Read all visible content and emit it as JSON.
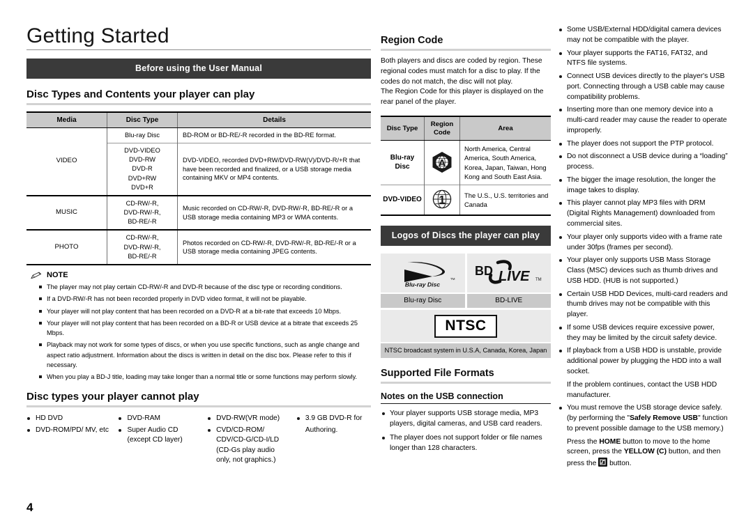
{
  "page": {
    "chapter_title": "Getting Started",
    "page_number": "4"
  },
  "left": {
    "banner": "Before using the User Manual",
    "section1_title": "Disc Types and Contents your player can play",
    "disc_table": {
      "headers": [
        "Media",
        "Disc Type",
        "Details"
      ],
      "rows": [
        {
          "media": "VIDEO",
          "groups": [
            {
              "disc_type": "Blu-ray Disc",
              "details": "BD-ROM or BD-RE/-R recorded in the BD-RE format."
            },
            {
              "disc_type": "DVD-VIDEO\nDVD-RW\nDVD-R\nDVD+RW\nDVD+R",
              "details": "DVD-VIDEO, recorded DVD+RW/DVD-RW(V)/DVD-R/+R that have been recorded and finalized, or a USB storage media containing MKV or MP4 contents."
            }
          ]
        },
        {
          "media": "MUSIC",
          "groups": [
            {
              "disc_type": "CD-RW/-R,\nDVD-RW/-R,\nBD-RE/-R",
              "details": "Music recorded on CD-RW/-R, DVD-RW/-R, BD-RE/-R or a USB storage media containing MP3 or WMA contents."
            }
          ]
        },
        {
          "media": "PHOTO",
          "groups": [
            {
              "disc_type": "CD-RW/-R,\nDVD-RW/-R,\nBD-RE/-R",
              "details": "Photos recorded on CD-RW/-R, DVD-RW/-R, BD-RE/-R or a USB storage media containing JPEG contents."
            }
          ]
        }
      ]
    },
    "note_label": "NOTE",
    "notes": [
      "The player may not play certain CD-RW/-R and DVD-R because of the disc type or recording conditions.",
      "If a DVD-RW/-R has not been recorded properly in DVD video format, it will not be playable.",
      "Your player will not play content that has been recorded on a DVD-R at a bit-rate that exceeds 10 Mbps.",
      "Your player will not play content that has been recorded on a BD-R or USB device at a bitrate that exceeds 25 Mbps.",
      "Playback may not work for some types of discs, or when you use specific functions, such as angle change and aspect ratio adjustment. Information about the discs is written in detail on the disc box. Please refer to this if necessary.",
      "When you play a BD-J title, loading may take longer than a normal title or some functions may perform slowly."
    ],
    "section2_title": "Disc types your player cannot play",
    "cannot_play": {
      "col1": [
        "HD DVD",
        "DVD-ROM/PD/ MV, etc"
      ],
      "col2": [
        "DVD-RAM",
        "Super Audio CD (except CD layer)"
      ],
      "col3": [
        "DVD-RW(VR mode)",
        "CVD/CD-ROM/ CDV/CD-G/CD-I/LD (CD-Gs play audio only, not graphics.)"
      ],
      "col4_bullet": "3.9 GB DVD-R for",
      "col4_cont": "Authoring."
    }
  },
  "middle": {
    "region_title": "Region Code",
    "region_paragraph1": "Both players and discs are coded by region. These regional codes must match for a disc to play. If the codes do not match, the disc will not play.",
    "region_paragraph2": "The Region Code for this player is displayed on the rear panel of the player.",
    "region_table": {
      "headers": [
        "Disc Type",
        "Region Code",
        "Area"
      ],
      "rows": [
        {
          "disc_type": "Blu-ray Disc",
          "code_glyph": "A",
          "code_icon": "region-a-hexagon-icon",
          "area": "North America, Central America, South America, Korea, Japan, Taiwan, Hong Kong and South East Asia."
        },
        {
          "disc_type": "DVD-VIDEO",
          "code_glyph": "1",
          "code_icon": "region-1-globe-icon",
          "area": "The U.S., U.S. territories and Canada"
        }
      ]
    },
    "logos_banner": "Logos of Discs the player can play",
    "logos": [
      {
        "logo_icon": "blu-ray-disc-logo",
        "logo_text": "Blu-ray Disc",
        "caption": "Blu-ray Disc"
      },
      {
        "logo_icon": "bd-live-logo",
        "logo_text": "BD LIVE",
        "caption": "BD-LIVE"
      }
    ],
    "ntsc_logo_text": "NTSC",
    "ntsc_caption": "NTSC broadcast system in U.S.A, Canada, Korea, Japan",
    "formats_title": "Supported File Formats",
    "usb_notes_title": "Notes on the USB connection",
    "usb_notes": [
      "Your player supports USB storage media, MP3 players, digital cameras, and USB card readers.",
      "The player does not support folder or file names longer than 128 characters."
    ]
  },
  "right": {
    "usb_notes_continued": [
      "Some USB/External HDD/digital camera devices may not be compatible with the player.",
      "Your player supports the FAT16, FAT32, and NTFS file systems.",
      "Connect USB devices directly to the player's USB port. Connecting through a USB cable may cause compatibility problems.",
      "Inserting more than one memory device into a multi-card reader may cause the reader to operate improperly.",
      "The player does not support the PTP protocol.",
      "Do not disconnect a USB device during a “loading” process.",
      "The bigger the image resolution, the longer the image takes to display.",
      "This player cannot play MP3 files with DRM (Digital Rights Management) downloaded from commercial sites.",
      "Your player only supports video with a frame rate under 30fps (frames per second).",
      "Your player only supports USB Mass Storage Class (MSC) devices such as thumb drives and USB HDD. (HUB is not supported.)",
      "Certain USB HDD Devices, multi-card readers and thumb drives may not be compatible with this player.",
      "If some USB devices require excessive power, they may be limited by the circuit safety device.",
      "If playback from a USB HDD is unstable, provide additional power by plugging the HDD into a wall socket."
    ],
    "continuation_line": "If the problem continues, contact the USB HDD manufacturer.",
    "last_bullet": {
      "part1": "You must remove the USB storage device safely. (by performing the \"",
      "bold1": "Safely Remove USB",
      "part2": "\" function to prevent possible damage to the USB memory.)"
    },
    "final_line": {
      "part1": "Press the ",
      "bold1": "HOME",
      "part2": " button to move to the home screen, press the ",
      "bold2": "YELLOW (C)",
      "part3": " button, and then press the ",
      "icon": "enter-button-icon",
      "part4": " button."
    }
  }
}
